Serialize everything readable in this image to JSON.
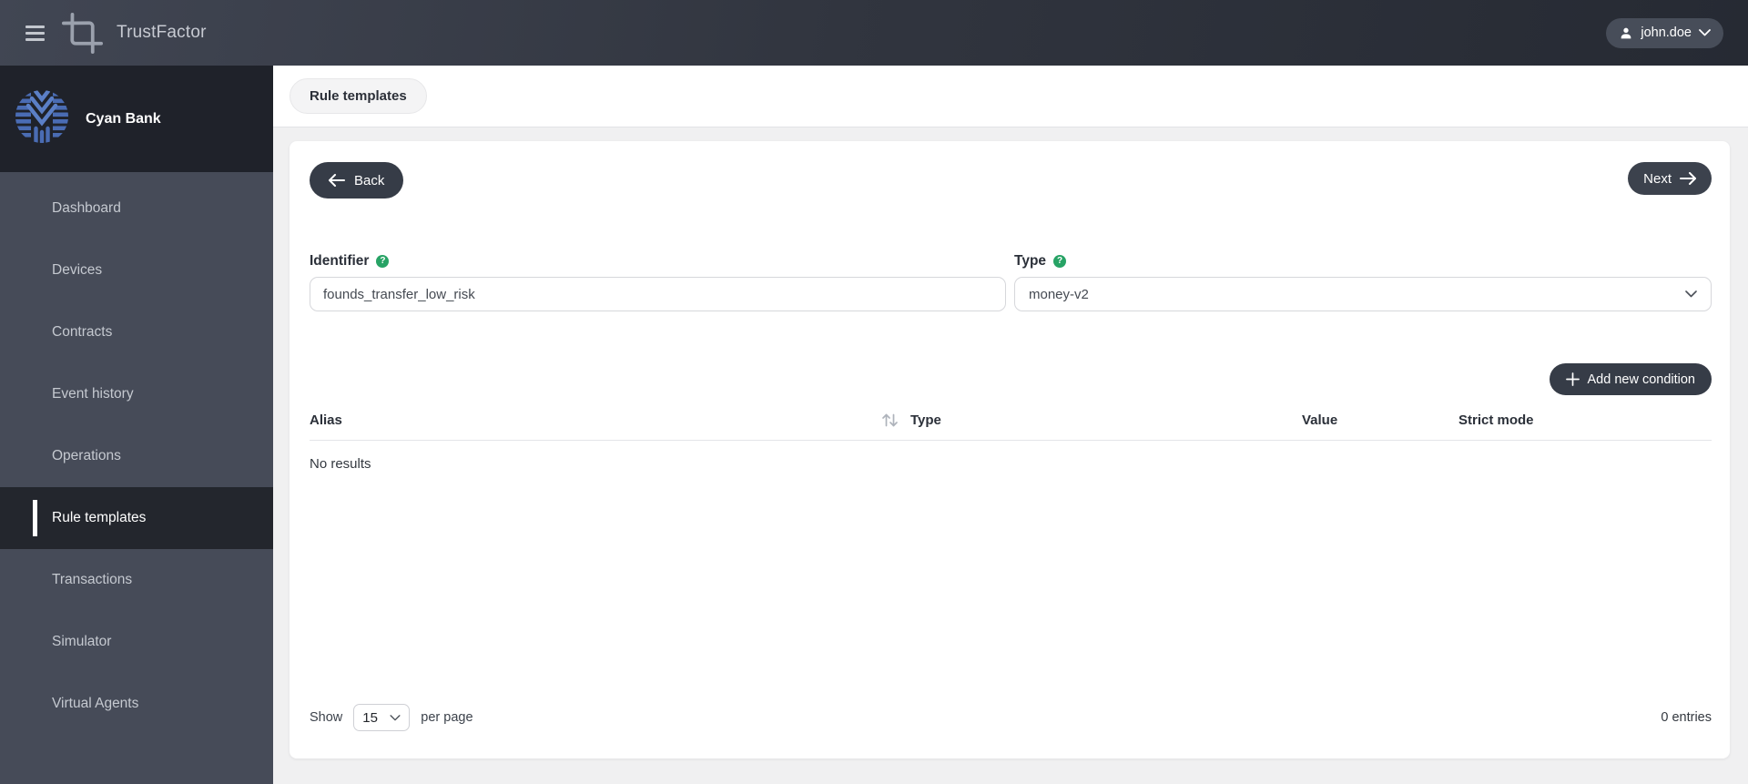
{
  "topbar": {
    "app_name": "TrustFactor",
    "user": {
      "name": "john.doe"
    }
  },
  "sidebar": {
    "org_name": "Cyan Bank",
    "items": [
      {
        "label": "Dashboard",
        "active": false
      },
      {
        "label": "Devices",
        "active": false
      },
      {
        "label": "Contracts",
        "active": false
      },
      {
        "label": "Event history",
        "active": false
      },
      {
        "label": "Operations",
        "active": false
      },
      {
        "label": "Rule templates",
        "active": true
      },
      {
        "label": "Transactions",
        "active": false
      },
      {
        "label": "Simulator",
        "active": false
      },
      {
        "label": "Virtual Agents",
        "active": false
      }
    ]
  },
  "breadcrumb": {
    "label": "Rule templates"
  },
  "wizard": {
    "back_label": "Back",
    "next_label": "Next"
  },
  "form": {
    "identifier": {
      "label": "Identifier",
      "value": "founds_transfer_low_risk"
    },
    "type": {
      "label": "Type",
      "value": "money-v2"
    }
  },
  "conditions": {
    "add_button_label": "Add new condition",
    "table": {
      "columns": [
        "Alias",
        "Type",
        "Value",
        "Strict mode"
      ],
      "empty_text": "No results"
    },
    "pagination": {
      "show_label": "Show",
      "page_size": "15",
      "per_page_label": "per page",
      "entries_text": "0 entries"
    }
  },
  "colors": {
    "topbar_gradient_start": "#414653",
    "topbar_gradient_end": "#262a33",
    "sidebar_bg": "#464b58",
    "sidebar_header_bg": "#1f222a",
    "active_item_bg": "#23262d",
    "dark_button_bg": "#363c47",
    "help_icon_green": "#27a365",
    "logo_blue": "#4a6cb3",
    "logo_blue_light": "#5b7fc6",
    "page_bg": "#f0f0f1"
  }
}
